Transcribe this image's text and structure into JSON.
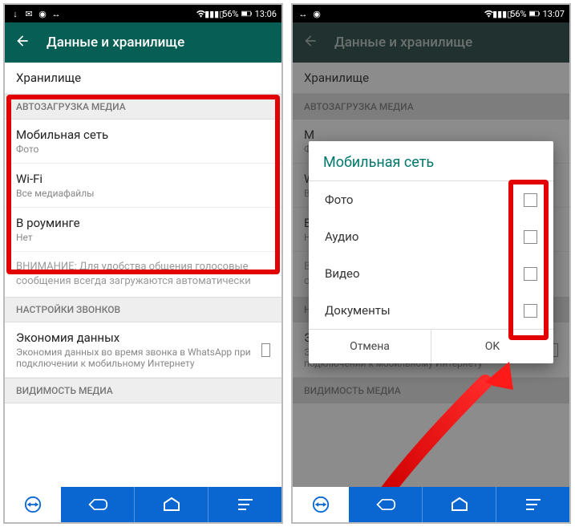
{
  "status": {
    "battery": "56%",
    "time_left": "13:06",
    "time_right": "13:07"
  },
  "appbar": {
    "title": "Данные и хранилище"
  },
  "sec_storage": {
    "title": "Хранилище"
  },
  "sec_autodl": {
    "header": "АВТОЗАГРУЗКА МЕДИА",
    "mobile": {
      "title": "Мобильная сеть",
      "sub": "Фото"
    },
    "wifi": {
      "title": "Wi-Fi",
      "sub": "Все медиафайлы"
    },
    "roaming": {
      "title": "В роуминге",
      "sub": "Нет"
    },
    "note": "ВНИМАНИЕ: Для удобства общения голосовые сообщения всегда загружаются автоматически"
  },
  "sec_calls": {
    "header": "НАСТРОЙКИ ЗВОНКОВ",
    "econ": {
      "title": "Экономия данных",
      "sub": "Экономия данных во время звонка в WhatsApp при подключении к мобильному Интернету"
    }
  },
  "sec_vis": {
    "header": "ВИДИМОСТЬ МЕДИА"
  },
  "dialog": {
    "title": "Мобильная сеть",
    "opt_photo": "Фото",
    "opt_audio": "Аудио",
    "opt_video": "Видео",
    "opt_docs": "Документы",
    "cancel": "Отмена",
    "ok": "OK"
  }
}
